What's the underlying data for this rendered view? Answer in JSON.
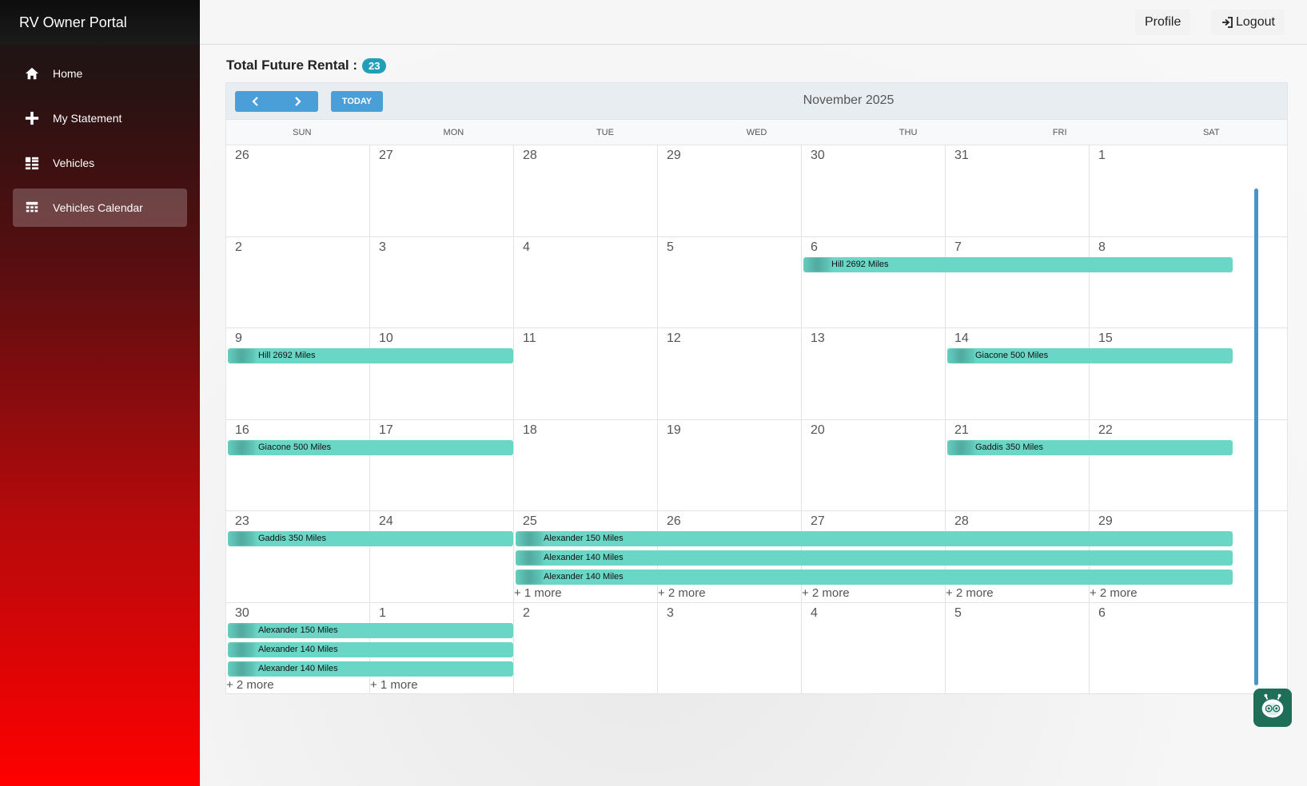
{
  "app": {
    "title": "RV Owner Portal"
  },
  "sidebar": {
    "items": [
      {
        "label": "Home",
        "icon": "home-icon",
        "active": false
      },
      {
        "label": "My Statement",
        "icon": "plus-icon",
        "active": false
      },
      {
        "label": "Vehicles",
        "icon": "list-icon",
        "active": false
      },
      {
        "label": "Vehicles Calendar",
        "icon": "calendar-icon",
        "active": true
      }
    ]
  },
  "topbar": {
    "profile_label": "Profile",
    "logout_label": "Logout"
  },
  "summary": {
    "label": "Total Future Rental :",
    "count": "23"
  },
  "calendar": {
    "month_title": "November 2025",
    "today_label": "TODAY",
    "weekdays": [
      "SUN",
      "MON",
      "TUE",
      "WED",
      "THU",
      "FRI",
      "SAT"
    ],
    "weeks": [
      [
        "26",
        "27",
        "28",
        "29",
        "30",
        "31",
        "1"
      ],
      [
        "2",
        "3",
        "4",
        "5",
        "6",
        "7",
        "8"
      ],
      [
        "9",
        "10",
        "11",
        "12",
        "13",
        "14",
        "15"
      ],
      [
        "16",
        "17",
        "18",
        "19",
        "20",
        "21",
        "22"
      ],
      [
        "23",
        "24",
        "25",
        "26",
        "27",
        "28",
        "29"
      ],
      [
        "30",
        "1",
        "2",
        "3",
        "4",
        "5",
        "6"
      ]
    ],
    "events": [
      {
        "week": 1,
        "start": 4,
        "end": 6,
        "slot": 0,
        "label": "Hill 2692 Miles"
      },
      {
        "week": 2,
        "start": 0,
        "end": 1,
        "slot": 0,
        "label": "Hill 2692 Miles"
      },
      {
        "week": 2,
        "start": 5,
        "end": 6,
        "slot": 0,
        "label": "Giacone 500 Miles"
      },
      {
        "week": 3,
        "start": 0,
        "end": 1,
        "slot": 0,
        "label": "Giacone 500 Miles"
      },
      {
        "week": 3,
        "start": 5,
        "end": 6,
        "slot": 0,
        "label": "Gaddis 350 Miles"
      },
      {
        "week": 4,
        "start": 0,
        "end": 1,
        "slot": 0,
        "label": "Gaddis 350 Miles"
      },
      {
        "week": 4,
        "start": 2,
        "end": 6,
        "slot": 0,
        "label": "Alexander 150 Miles"
      },
      {
        "week": 4,
        "start": 2,
        "end": 6,
        "slot": 1,
        "label": "Alexander 140 Miles"
      },
      {
        "week": 4,
        "start": 2,
        "end": 6,
        "slot": 2,
        "label": "Alexander 140 Miles"
      },
      {
        "week": 5,
        "start": 0,
        "end": 1,
        "slot": 0,
        "label": "Alexander 150 Miles"
      },
      {
        "week": 5,
        "start": 0,
        "end": 1,
        "slot": 1,
        "label": "Alexander 140 Miles"
      },
      {
        "week": 5,
        "start": 0,
        "end": 1,
        "slot": 2,
        "label": "Alexander 140 Miles"
      }
    ],
    "more_links": [
      {
        "week": 4,
        "day": 2,
        "label": "+ 1 more"
      },
      {
        "week": 4,
        "day": 3,
        "label": "+ 2 more"
      },
      {
        "week": 4,
        "day": 4,
        "label": "+ 2 more"
      },
      {
        "week": 4,
        "day": 5,
        "label": "+ 2 more"
      },
      {
        "week": 4,
        "day": 6,
        "label": "+ 2 more"
      },
      {
        "week": 5,
        "day": 0,
        "label": "+ 2 more"
      },
      {
        "week": 5,
        "day": 1,
        "label": "+ 1 more"
      }
    ]
  },
  "colors": {
    "event": "#6ad6c6",
    "button": "#4a9fd8",
    "badge": "#1fa0b8",
    "sidebar_top": "#161616",
    "sidebar_bottom": "#ff0000"
  }
}
